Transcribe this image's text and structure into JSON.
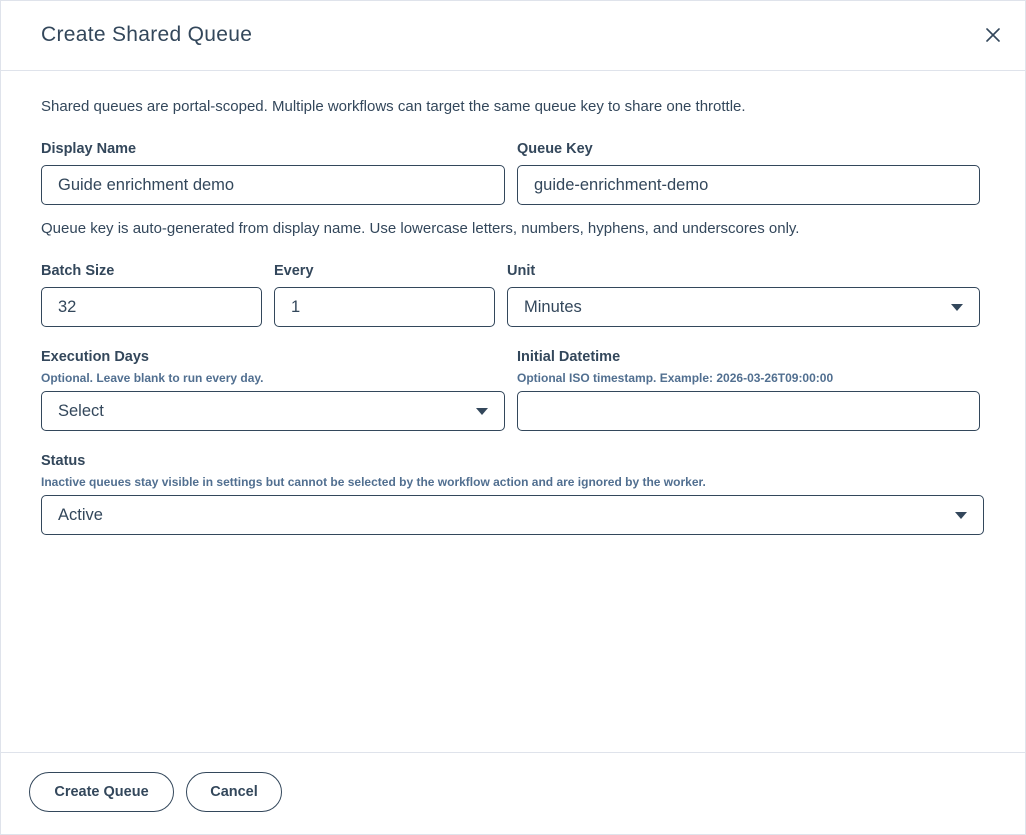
{
  "dialog": {
    "title": "Create Shared Queue",
    "intro": "Shared queues are portal-scoped. Multiple workflows can target the same queue key to share one throttle."
  },
  "display_name": {
    "label": "Display Name",
    "value": "Guide enrichment demo"
  },
  "queue_key": {
    "label": "Queue Key",
    "value": "guide-enrichment-demo",
    "help": "Queue key is auto-generated from display name. Use lowercase letters, numbers, hyphens, and underscores only."
  },
  "batch_size": {
    "label": "Batch Size",
    "value": "32"
  },
  "every": {
    "label": "Every",
    "value": "1"
  },
  "unit": {
    "label": "Unit",
    "selected": "Minutes"
  },
  "execution_days": {
    "label": "Execution Days",
    "hint": "Optional. Leave blank to run every day.",
    "selected": "Select"
  },
  "initial_datetime": {
    "label": "Initial Datetime",
    "hint": "Optional ISO timestamp. Example: 2026-03-26T09:00:00",
    "value": ""
  },
  "status": {
    "label": "Status",
    "hint": "Inactive queues stay visible in settings but cannot be selected by the workflow action and are ignored by the worker.",
    "selected": "Active"
  },
  "footer": {
    "create_label": "Create Queue",
    "cancel_label": "Cancel"
  },
  "icons": {
    "close": "close-icon",
    "dropdown": "chevron-down-icon"
  }
}
